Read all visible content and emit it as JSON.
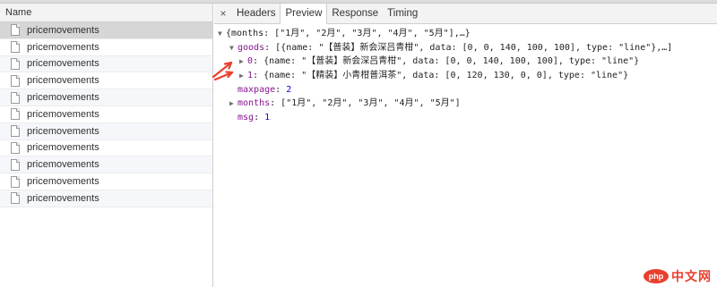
{
  "left_pane": {
    "header": "Name",
    "rows": [
      "pricemovements",
      "pricemovements",
      "pricemovements",
      "pricemovements",
      "pricemovements",
      "pricemovements",
      "pricemovements",
      "pricemovements",
      "pricemovements",
      "pricemovements",
      "pricemovements"
    ],
    "selected_index": 0
  },
  "tabs": {
    "close": "×",
    "items": [
      "Headers",
      "Preview",
      "Response",
      "Timing"
    ],
    "active": "Preview"
  },
  "preview": {
    "root_summary": "{months: [\"1月\", \"2月\", \"3月\", \"4月\", \"5月\"],…}",
    "goods_key": "goods",
    "goods_summary": "[{name: \"【普装】新会深吕青柑\", data: [0, 0, 140, 100, 100], type: \"line\"},…]",
    "goods_item0_key": "0",
    "goods_item0_summary": "{name: \"【普装】新会深吕青柑\", data: [0, 0, 140, 100, 100], type: \"line\"}",
    "goods_item1_key": "1",
    "goods_item1_summary": "{name: \"【精装】小青柑普洱茶\", data: [0, 120, 130, 0, 0], type: \"line\"}",
    "maxpage_key": "maxpage",
    "maxpage_value": "2",
    "months_key": "months",
    "months_value": "[\"1月\", \"2月\", \"3月\", \"4月\", \"5月\"]",
    "msg_key": "msg",
    "msg_value": "1"
  },
  "watermark": {
    "logo": "php",
    "text": "中文网"
  },
  "colors": {
    "key": "#881391",
    "number": "#1c00cf",
    "arrow": "#e8402e",
    "selected_row": "#d6d6d6"
  }
}
